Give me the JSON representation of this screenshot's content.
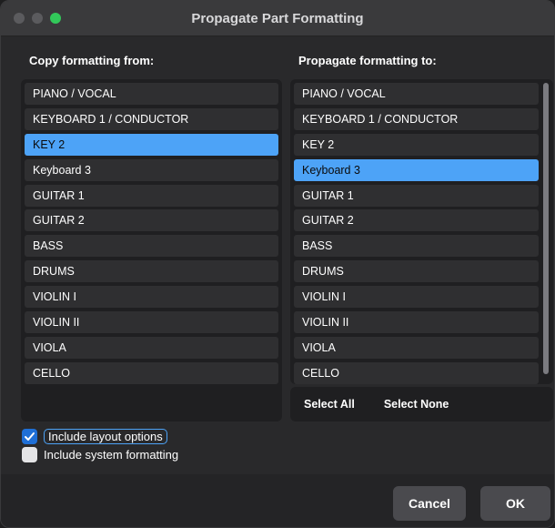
{
  "window": {
    "title": "Propagate Part Formatting",
    "accent": "#4da3f7"
  },
  "from": {
    "title": "Copy formatting from:",
    "selected_index": 2,
    "items": [
      "PIANO / VOCAL",
      "KEYBOARD 1 / CONDUCTOR",
      "KEY 2",
      "Keyboard 3",
      "GUITAR 1",
      "GUITAR 2",
      "BASS",
      "DRUMS",
      "VIOLIN I",
      "VIOLIN II",
      "VIOLA",
      "CELLO"
    ]
  },
  "to": {
    "title": "Propagate formatting to:",
    "selected_index": 3,
    "items": [
      "PIANO / VOCAL",
      "KEYBOARD 1 / CONDUCTOR",
      "KEY 2",
      "Keyboard 3",
      "GUITAR 1",
      "GUITAR 2",
      "BASS",
      "DRUMS",
      "VIOLIN I",
      "VIOLIN II",
      "VIOLA",
      "CELLO"
    ],
    "select_all": "Select All",
    "select_none": "Select None"
  },
  "options": {
    "layout": {
      "label": "Include layout options",
      "checked": true
    },
    "system": {
      "label": "Include system formatting",
      "checked": false
    }
  },
  "buttons": {
    "cancel": "Cancel",
    "ok": "OK"
  }
}
